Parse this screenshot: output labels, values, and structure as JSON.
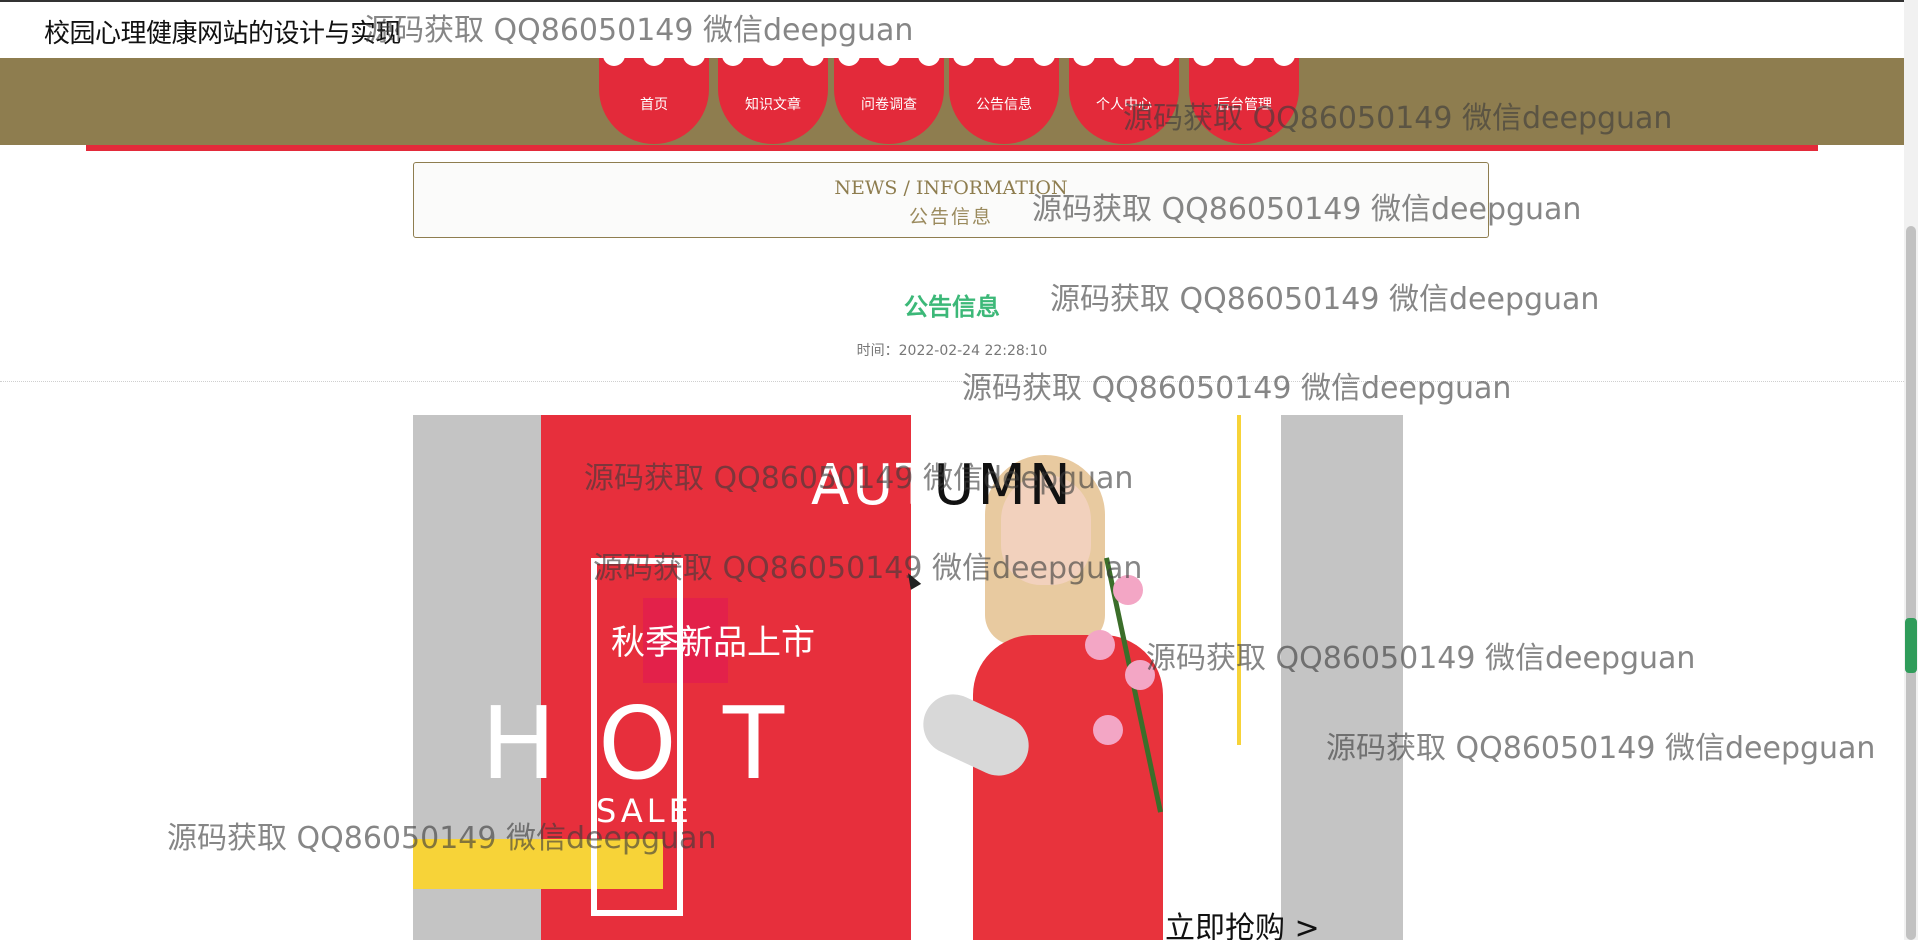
{
  "site": {
    "title": "校园心理健康网站的设计与实现"
  },
  "nav": {
    "items": [
      {
        "label": "首页"
      },
      {
        "label": "知识文章"
      },
      {
        "label": "问卷调查"
      },
      {
        "label": "公告信息"
      },
      {
        "label": "个人中心"
      },
      {
        "label": "后台管理"
      }
    ]
  },
  "section": {
    "title_en": "NEWS / INFORMATION",
    "title_cn": "公告信息"
  },
  "notice": {
    "title": "公告信息",
    "time": "时间：2022-02-24 22:28:10"
  },
  "banner": {
    "hot_letters": [
      "H",
      "O",
      "T"
    ],
    "sale": "SALE",
    "tag": "秋季新品上市",
    "autumn_white": "AUT",
    "autumn_black": "UMN",
    "buy": "立即抢购 >"
  },
  "watermark": {
    "text": "源码获取 QQ86050149 微信deepguan"
  },
  "colors": {
    "nav_bg": "#8e7d4f",
    "nav_item": "#e32a3a",
    "notice_title": "#3cb878"
  }
}
